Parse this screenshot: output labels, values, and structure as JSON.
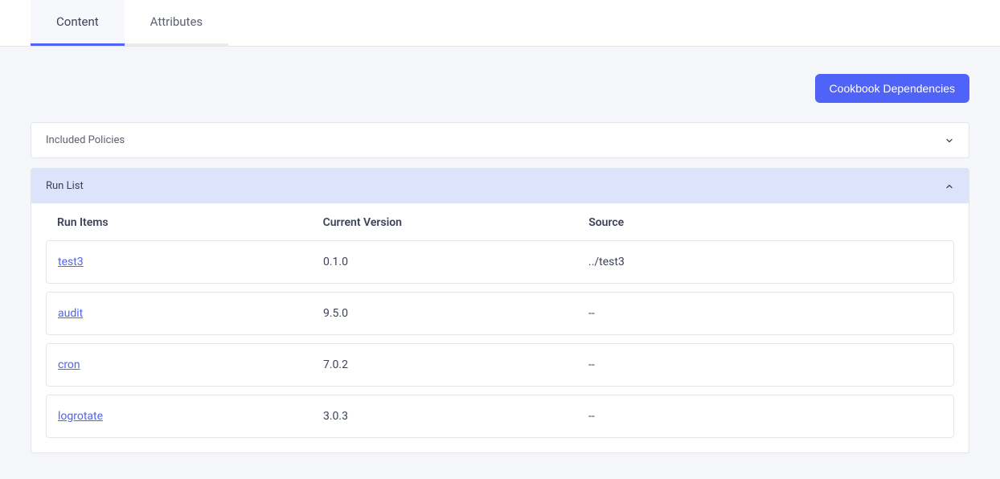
{
  "tabs": [
    {
      "id": "content",
      "label": "Content",
      "active": true
    },
    {
      "id": "attributes",
      "label": "Attributes",
      "active": false
    }
  ],
  "actions": {
    "cookbook_dependencies": "Cookbook Dependencies"
  },
  "panels": {
    "included_policies": {
      "title": "Included Policies",
      "expanded": false
    },
    "run_list": {
      "title": "Run List",
      "expanded": true,
      "columns": {
        "name": "Run Items",
        "version": "Current Version",
        "source": "Source"
      },
      "items": [
        {
          "name": "test3",
          "version": "0.1.0",
          "source": "../test3"
        },
        {
          "name": "audit",
          "version": "9.5.0",
          "source": "--"
        },
        {
          "name": "cron",
          "version": "7.0.2",
          "source": "--"
        },
        {
          "name": "logrotate",
          "version": "3.0.3",
          "source": "--"
        }
      ]
    }
  }
}
